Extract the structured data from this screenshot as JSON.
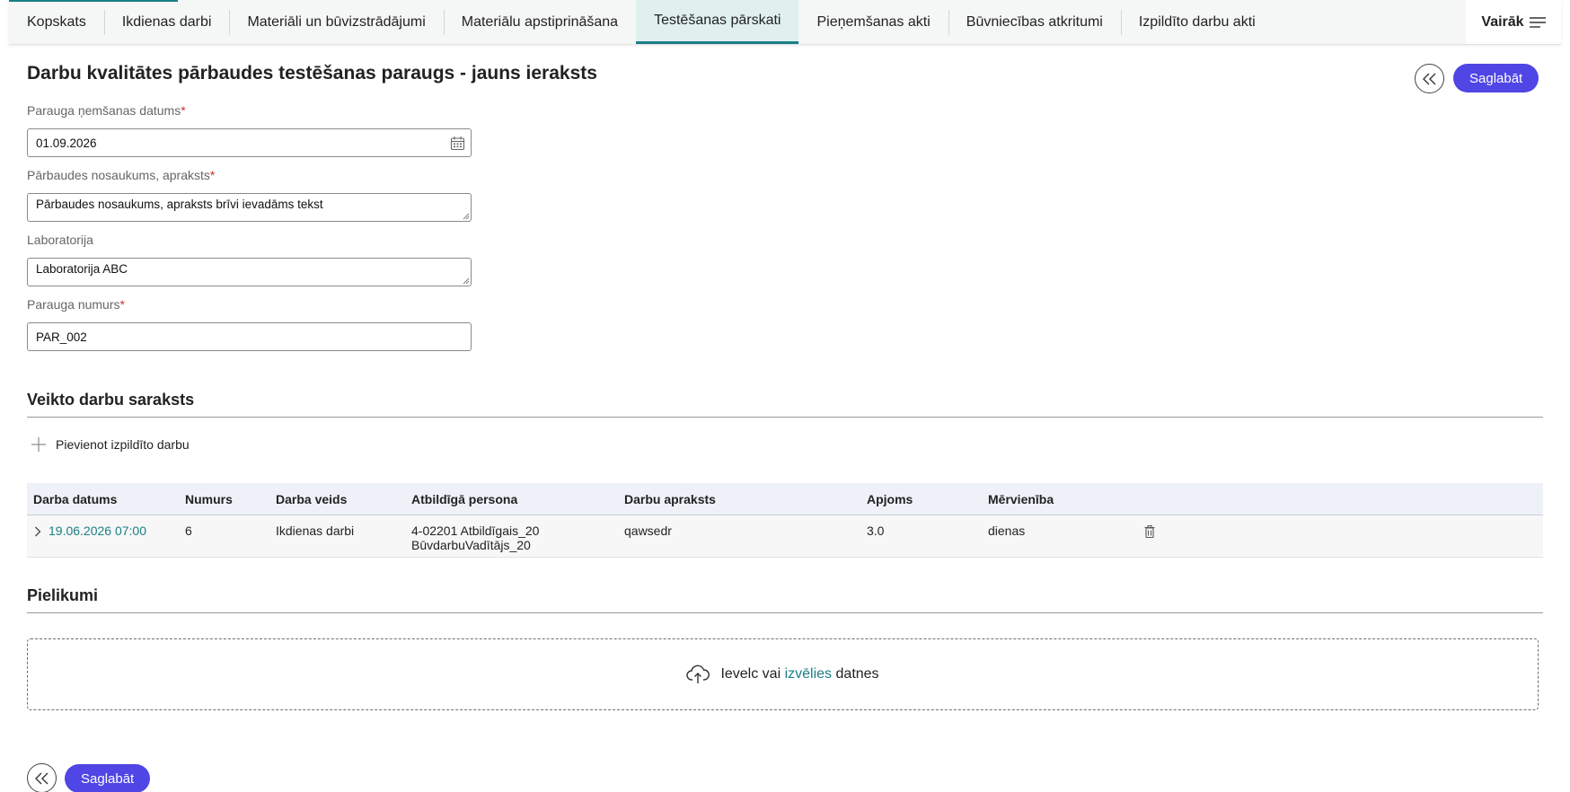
{
  "tabs": [
    {
      "label": "Kopskats",
      "active": false
    },
    {
      "label": "Ikdienas darbi",
      "active": false
    },
    {
      "label": "Materiāli un būvizstrādājumi",
      "active": false
    },
    {
      "label": "Materiālu apstiprināšana",
      "active": false
    },
    {
      "label": "Testēšanas pārskati",
      "active": true
    },
    {
      "label": "Pieņemšanas akti",
      "active": false
    },
    {
      "label": "Būvniecības atkritumi",
      "active": false
    },
    {
      "label": "Izpildīto darbu akti",
      "active": false
    }
  ],
  "more_label": "Vairāk",
  "page_title": "Darbu kvalitātes pārbaudes testēšanas paraugs - jauns ieraksts",
  "save_label": "Saglabāt",
  "form": {
    "date": {
      "label": "Parauga ņemšanas datums",
      "value": "01.09.2026"
    },
    "name": {
      "label": "Pārbaudes nosaukums, apraksts",
      "value": "Pārbaudes nosaukums, apraksts brīvi ievadāms tekst"
    },
    "lab": {
      "label": "Laboratorija",
      "value": "Laboratorija ABC"
    },
    "sample_no": {
      "label": "Parauga numurs",
      "value": "PAR_002"
    },
    "required_mark": "*"
  },
  "works": {
    "title": "Veikto darbu saraksts",
    "add_label": "Pievienot izpildīto darbu",
    "columns": [
      "Darba datums",
      "Numurs",
      "Darba veids",
      "Atbildīgā persona",
      "Darbu apraksts",
      "Apjoms",
      "Mērvienība"
    ],
    "rows": [
      {
        "date": "19.06.2026 07:00",
        "number": "6",
        "type": "Ikdienas darbi",
        "person_line1": "4-02201 Atbildīgais_20",
        "person_line2": "BūvdarbuVadītājs_20",
        "description": "qawsedr",
        "amount": "3.0",
        "unit": "dienas"
      }
    ]
  },
  "attachments": {
    "title": "Pielikumi",
    "drop_text_pre": "Ievelc vai",
    "drop_link": "izvēlies",
    "drop_text_post": "datnes"
  },
  "colors": {
    "accent": "#1a7f86",
    "primary_button": "#4f46e5"
  }
}
